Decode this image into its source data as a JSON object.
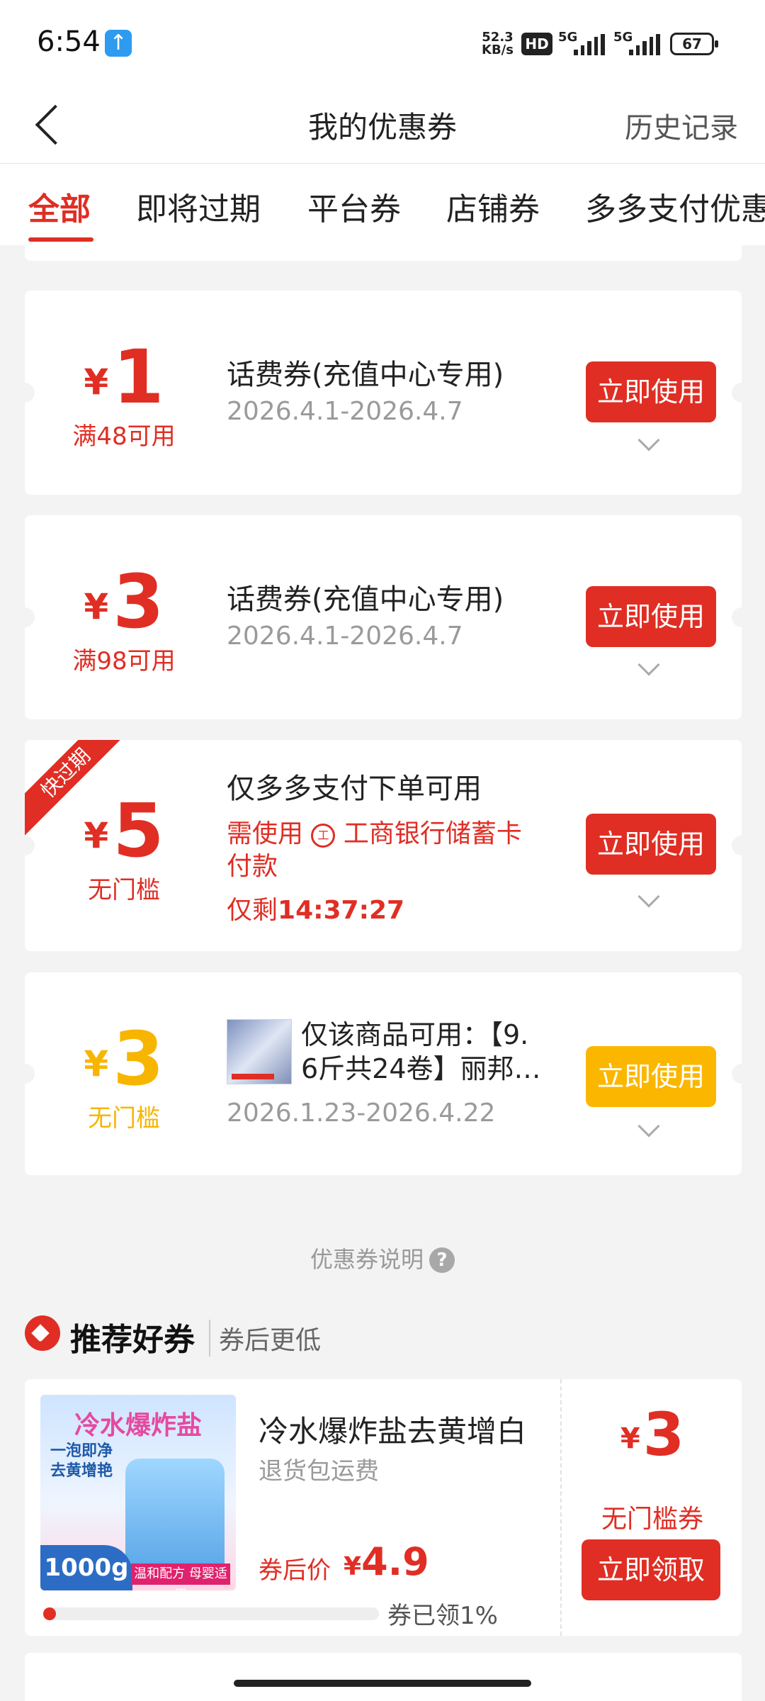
{
  "status": {
    "time": "6:54",
    "upload_badge": "↑",
    "net_speed_value": "52.3",
    "net_speed_unit": "KB/s",
    "hd": "HD",
    "sim1": "5G",
    "sim2": "5G",
    "battery": "67"
  },
  "nav": {
    "title": "我的优惠券",
    "history": "历史记录"
  },
  "tabs": [
    "全部",
    "即将过期",
    "平台券",
    "店铺券",
    "多多支付优惠"
  ],
  "coupons": [
    {
      "yen": "¥",
      "amount": "1",
      "condition": "满48可用",
      "title": "话费券(充值中心专用)",
      "date": "2026.4.1-2026.4.7",
      "button": "立即使用"
    },
    {
      "yen": "¥",
      "amount": "3",
      "condition": "满98可用",
      "title": "话费券(充值中心专用)",
      "date": "2026.4.1-2026.4.7",
      "button": "立即使用"
    },
    {
      "yen": "¥",
      "amount": "5",
      "condition": "无门槛",
      "ribbon": "快过期",
      "title": "仅多多支付下单可用",
      "line1": "需使用",
      "bank": "工商银行储蓄卡",
      "line2": "付款",
      "countdown_prefix": "仅剩",
      "countdown": "14:37:27",
      "button": "立即使用"
    },
    {
      "yen": "¥",
      "amount": "3",
      "condition": "无门槛",
      "title_line1": "仅该商品可用：【9.",
      "title_line2": "6斤共24卷】丽邦…",
      "date": "2026.1.23-2026.4.22",
      "button": "立即使用"
    }
  ],
  "explain": {
    "label": "优惠券说明",
    "icon": "?"
  },
  "recommend": {
    "title": "推荐好券",
    "subtitle": "券后更低",
    "card": {
      "img_title": "冷水爆炸盐",
      "img_line1": "一泡即净",
      "img_line2": "去黄增艳",
      "img_weight": "1000g",
      "img_band": "温和配方 母婴适用",
      "name": "冷水爆炸盐去黄增白",
      "tag": "退货包运费",
      "price_label": "券后价",
      "price_yen": "¥",
      "price": "4.9",
      "coupon_yen": "¥",
      "coupon_amount": "3",
      "coupon_condition": "无门槛券",
      "claim_button": "立即领取",
      "claimed_text": "券已领1%",
      "claimed_fraction": 0.01
    }
  },
  "colors": {
    "accent": "#e02e24",
    "yellow": "#fbb700",
    "background": "#f3f3f3"
  }
}
